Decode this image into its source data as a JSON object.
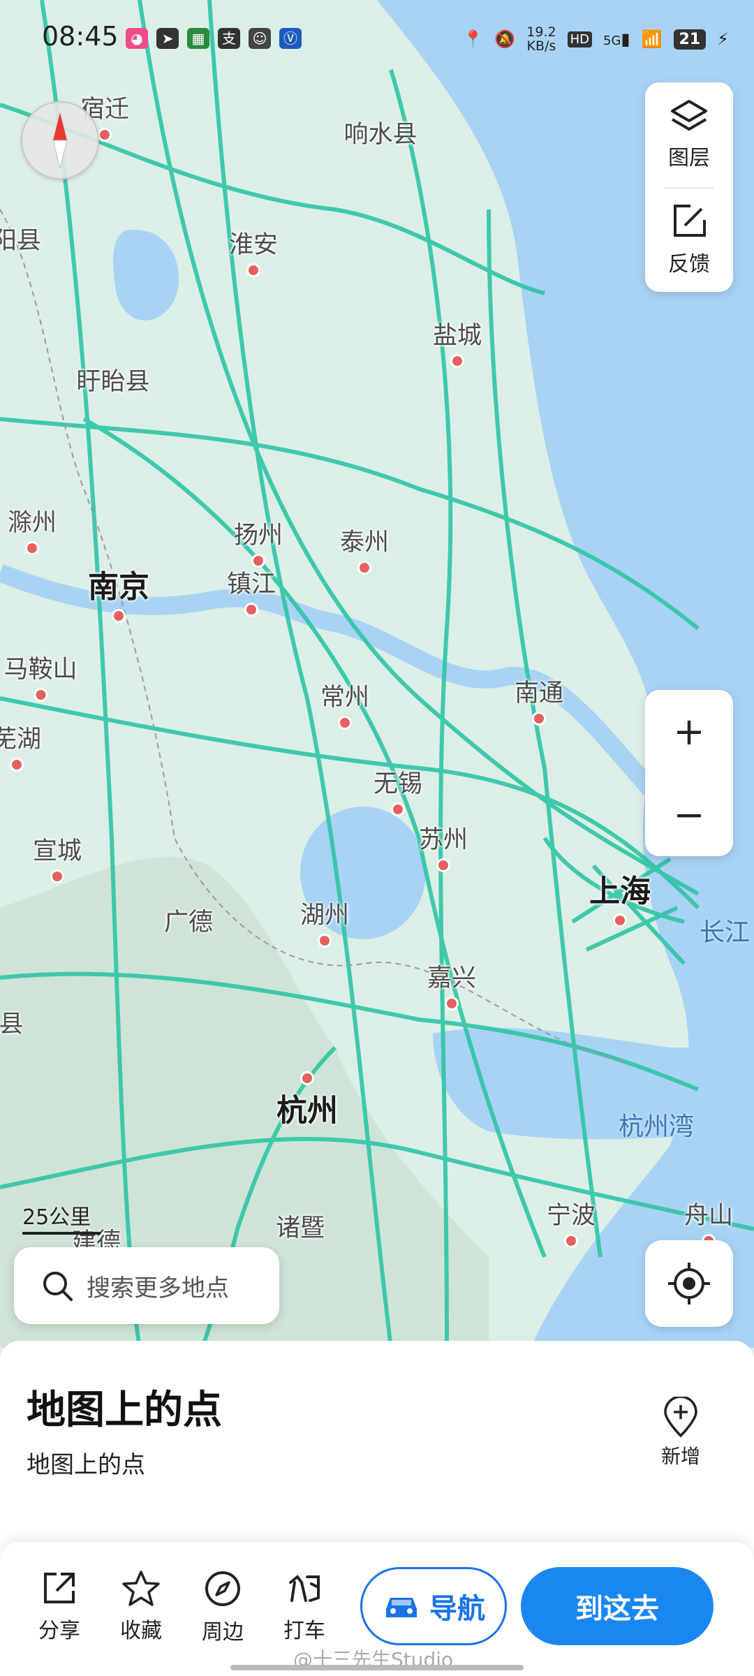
{
  "status_bar": {
    "time": "08:45",
    "net_speed": "19.2",
    "net_speed_unit": "KB/s",
    "hd": "HD",
    "network": "5G",
    "battery": "21"
  },
  "map": {
    "cities": [
      {
        "name": "宿迁"
      },
      {
        "name": "响水县"
      },
      {
        "name": "阳县"
      },
      {
        "name": "淮安"
      },
      {
        "name": "盐城"
      },
      {
        "name": "盱眙县"
      },
      {
        "name": "滁州"
      },
      {
        "name": "扬州"
      },
      {
        "name": "泰州"
      },
      {
        "name": "南京"
      },
      {
        "name": "镇江"
      },
      {
        "name": "马鞍山"
      },
      {
        "name": "常州"
      },
      {
        "name": "南通"
      },
      {
        "name": "芜湖"
      },
      {
        "name": "无锡"
      },
      {
        "name": "苏州"
      },
      {
        "name": "宣城"
      },
      {
        "name": "上海"
      },
      {
        "name": "广德"
      },
      {
        "name": "湖州"
      },
      {
        "name": "嘉兴"
      },
      {
        "name": "县"
      },
      {
        "name": "杭州"
      },
      {
        "name": "诸暨"
      },
      {
        "name": "宁波"
      },
      {
        "name": "舟山"
      },
      {
        "name": "建德"
      }
    ],
    "water_labels": [
      "长江",
      "杭州湾"
    ],
    "scale_label": "25公里"
  },
  "controls": {
    "layers_label": "图层",
    "feedback_label": "反馈",
    "zoom_in": "+",
    "zoom_out": "−"
  },
  "search": {
    "placeholder": "搜索更多地点"
  },
  "sheet": {
    "title": "地图上的点",
    "subtitle": "地图上的点",
    "add_label": "新增"
  },
  "actions": [
    {
      "label": "分享",
      "icon": "share-icon"
    },
    {
      "label": "收藏",
      "icon": "star-icon"
    },
    {
      "label": "周边",
      "icon": "compass-icon"
    },
    {
      "label": "打车",
      "icon": "taxi-icon"
    }
  ],
  "navigate_label": "导航",
  "go_label": "到这去",
  "watermark": "@十三先生Studio",
  "colors": {
    "road": "#2fc4a5",
    "land": "#dfeee9",
    "water": "#a9d3f5",
    "accent": "#1a86f2",
    "poi": "#e66060"
  }
}
